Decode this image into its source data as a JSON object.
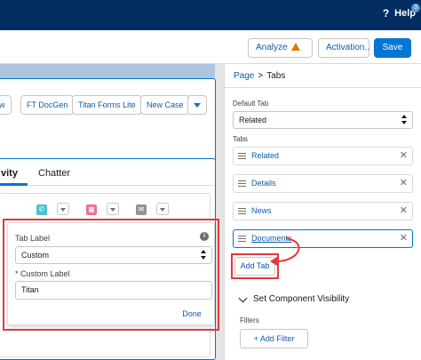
{
  "topbar": {
    "help_label": "Help",
    "help_badge": "3",
    "help_icon": "question-icon"
  },
  "header": {
    "analyze_label": "Analyze",
    "activation_label": "Activation...",
    "save_label": "Save"
  },
  "canvas": {
    "action_buttons": [
      "ow",
      "FT DocGen",
      "Titan Forms Lite",
      "New Case"
    ],
    "tabs": {
      "activity": "vity",
      "chatter": "Chatter"
    }
  },
  "popover": {
    "tab_label_title": "Tab Label",
    "tab_label_value": "Custom",
    "custom_label_title": "Custom Label",
    "custom_label_value": "Titan",
    "done_label": "Done"
  },
  "panel": {
    "breadcrumb": {
      "page": "Page",
      "separator": ">",
      "current": "Tabs"
    },
    "default_tab_label": "Default Tab",
    "default_tab_value": "Related",
    "tabs_label": "Tabs",
    "tabs": [
      "Related",
      "Details",
      "News",
      "Documents"
    ],
    "add_tab_label": "Add Tab",
    "visibility_title": "Set Component Visibility",
    "filters_label": "Filters",
    "add_filter_label": "Add Filter"
  },
  "colors": {
    "brand_dark": "#032d60",
    "accent": "#0176d3",
    "highlight": "#e0393e",
    "warning": "#dd7a01"
  }
}
